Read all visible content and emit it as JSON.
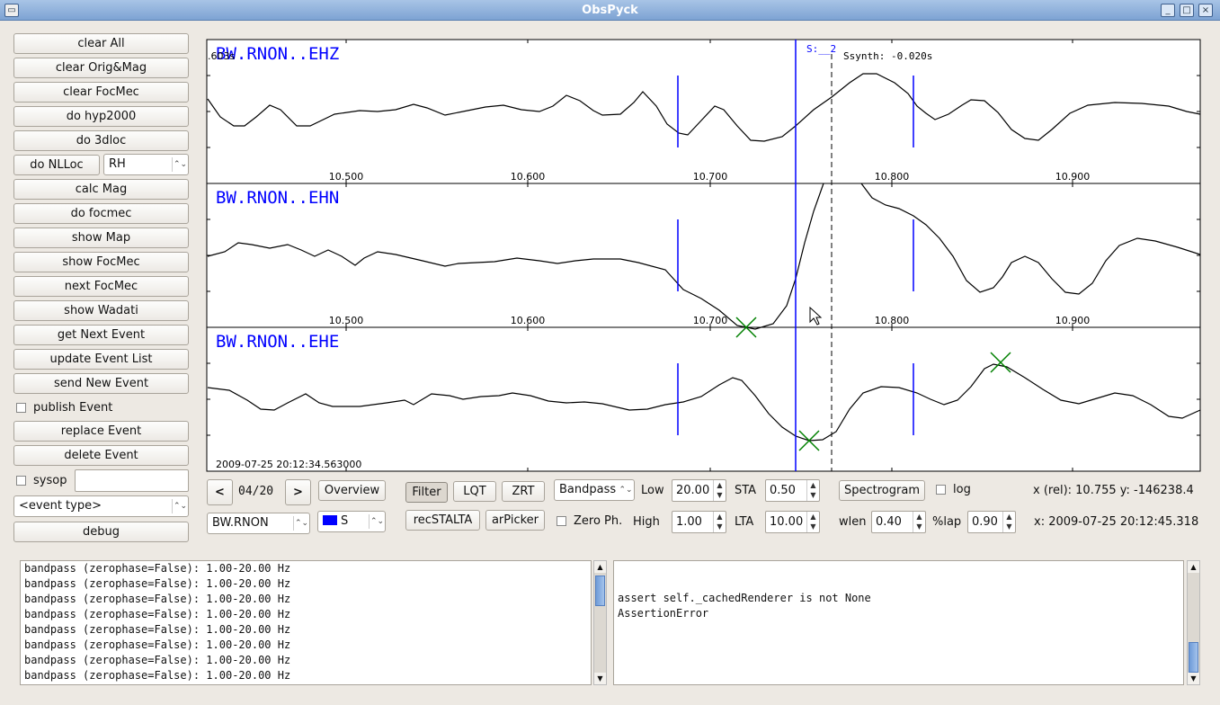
{
  "window": {
    "title": "ObsPyck"
  },
  "sidebar": {
    "buttons": [
      "clear All",
      "clear Orig&Mag",
      "clear FocMec",
      "do hyp2000",
      "do 3dloc"
    ],
    "nlloc_label": "do NLLoc",
    "nlloc_model": "RH",
    "buttons2": [
      "calc Mag",
      "do focmec",
      "show Map",
      "show FocMec",
      "next FocMec",
      "show Wadati",
      "get Next Event",
      "update Event List",
      "send New Event"
    ],
    "publish_label": "publish Event",
    "buttons3": [
      "replace Event",
      "delete Event"
    ],
    "sysop_label": "sysop",
    "sysop_value": "",
    "event_type": "<event type>",
    "debug_label": "debug"
  },
  "plot": {
    "traces": [
      "BW.RNON..EHZ",
      "BW.RNON..EHN",
      "BW.RNON..EHE"
    ],
    "xticks": [
      "10.500",
      "10.600",
      "10.700",
      "10.800",
      "10.900"
    ],
    "pick_label": "S:__2",
    "synth_label": "Ssynth: -0.020s",
    "offset_label": ".603s",
    "start_time": "2009-07-25  20:12:34.563000",
    "colors": {
      "pick": "#0000ff",
      "theo": "#008000",
      "trace": "#000000"
    }
  },
  "toolbar": {
    "prev": "<",
    "counter": "04/20",
    "next": ">",
    "overview": "Overview",
    "station": "BW.RNON",
    "phase": "S",
    "phase_color": "#0000ff",
    "filter": "Filter",
    "lqt": "LQT",
    "zrt": "ZRT",
    "recstalta": "recSTALTA",
    "arpicker": "arPicker",
    "filter_type": "Bandpass",
    "zerophase": "Zero Ph.",
    "low_label": "Low",
    "low": "20.00",
    "high_label": "High",
    "high": "1.00",
    "sta_label": "STA",
    "sta": "0.50",
    "lta_label": "LTA",
    "lta": "10.00",
    "spectrogram": "Spectrogram",
    "log": "log",
    "wlen_label": "wlen",
    "wlen": "0.40",
    "lap_label": "%lap",
    "lap": "0.90",
    "xrel": "x (rel):  10.755   y:  -146238.4",
    "xabs": "x:  2009-07-25  20:12:45.318"
  },
  "log_left": [
    "bandpass (zerophase=False): 1.00-20.00 Hz",
    "bandpass (zerophase=False): 1.00-20.00 Hz",
    "bandpass (zerophase=False): 1.00-20.00 Hz",
    "bandpass (zerophase=False): 1.00-20.00 Hz",
    "bandpass (zerophase=False): 1.00-20.00 Hz",
    "bandpass (zerophase=False): 1.00-20.00 Hz",
    "bandpass (zerophase=False): 1.00-20.00 Hz",
    "bandpass (zerophase=False): 1.00-20.00 Hz"
  ],
  "log_right": [
    "",
    "",
    "assert self._cachedRenderer is not None",
    "",
    "AssertionError"
  ]
}
